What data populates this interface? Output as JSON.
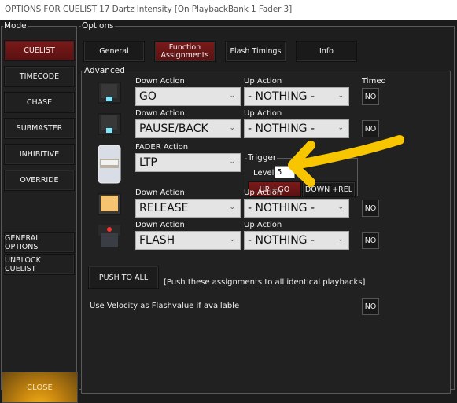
{
  "window": {
    "title": "OPTIONS FOR CUELIST 17 Dartz Intensity  [On PlaybackBank 1 Fader 3]"
  },
  "mode": {
    "legend": "Mode",
    "buttons": [
      {
        "label": "CUELIST",
        "active": true
      },
      {
        "label": "TIMECODE",
        "active": false
      },
      {
        "label": "CHASE",
        "active": false
      },
      {
        "label": "SUBMASTER",
        "active": false
      },
      {
        "label": "INHIBITIVE",
        "active": false
      },
      {
        "label": "OVERRIDE",
        "active": false
      }
    ],
    "general_options": "GENERAL OPTIONS",
    "unblock_cuelist": "UNBLOCK CUELIST",
    "close": "CLOSE"
  },
  "options": {
    "legend": "Options",
    "tabs": [
      {
        "label": "General",
        "active": false
      },
      {
        "label": "Function Assignments",
        "active": true
      },
      {
        "label": "Flash Timings",
        "active": false
      },
      {
        "label": "Info",
        "active": false
      }
    ]
  },
  "advanced": {
    "legend": "Advanced",
    "timed_label": "Timed",
    "rows": [
      {
        "icon": "button-blue-led-icon",
        "down_label": "Down Action",
        "down_value": "GO",
        "up_label": "Up Action",
        "up_value": "- NOTHING -",
        "timed": "NO"
      },
      {
        "icon": "button-blue-led-icon",
        "down_label": "Down Action",
        "down_value": "PAUSE/BACK",
        "up_label": "Up Action",
        "up_value": "- NOTHING -",
        "timed": "NO"
      },
      {
        "icon": "fader-icon",
        "down_label": "FADER Action",
        "down_value": "LTP"
      },
      {
        "icon": "button-amber-icon",
        "down_label": "Down Action",
        "down_value": "RELEASE",
        "up_label": "Up Action",
        "up_value": "- NOTHING -",
        "timed": "NO"
      },
      {
        "icon": "button-red-led-icon",
        "down_label": "Down Action",
        "down_value": "FLASH",
        "up_label": "Up Action",
        "up_value": "- NOTHING -",
        "timed": "NO"
      }
    ],
    "trigger": {
      "legend": "Trigger",
      "level_label": "Level",
      "level_value": "5",
      "up_go": "UP +GO",
      "down_rel": "DOWN +REL"
    },
    "push_to_all": "PUSH TO ALL",
    "push_note": "[Push these assignments to all identical playbacks]",
    "velocity_label": "Use Velocity as Flashvalue if available",
    "velocity_value": "NO"
  },
  "colors": {
    "active_red": "#6b1515",
    "close_amber": "#f4b21a",
    "annotation_arrow": "#f7c600"
  }
}
